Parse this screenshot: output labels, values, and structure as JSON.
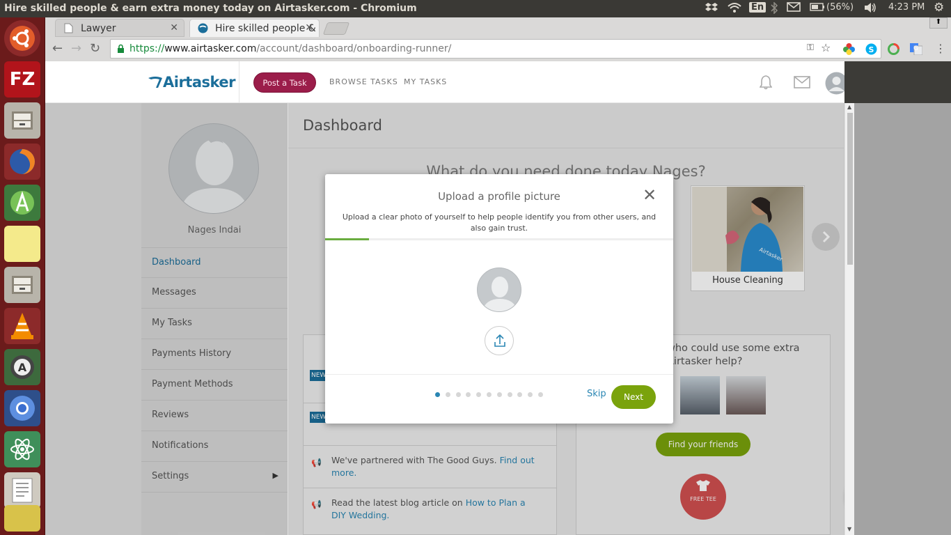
{
  "os": {
    "window_title": "Hire skilled people & earn extra money today on Airtasker.com - Chromium",
    "keyboard_layout": "En",
    "battery": "(56%)",
    "time": "4:23 PM"
  },
  "browser": {
    "tabs": [
      {
        "label": "Lawyer",
        "active": false
      },
      {
        "label": "Hire skilled people & earn",
        "active": true
      }
    ],
    "url_scheme": "https://",
    "url_host": "www.airtasker.com",
    "url_path": "/account/dashboard/onboarding-runner/"
  },
  "site_header": {
    "logo": "Airtasker",
    "post_task_label": "Post a Task",
    "nav": [
      "BROWSE TASKS",
      "MY TASKS"
    ]
  },
  "sidebar": {
    "user_name": "Nages Indai",
    "menu": [
      {
        "label": "Dashboard",
        "active": true
      },
      {
        "label": "Messages",
        "active": false
      },
      {
        "label": "My Tasks",
        "active": false
      },
      {
        "label": "Payments History",
        "active": false
      },
      {
        "label": "Payment Methods",
        "active": false
      },
      {
        "label": "Reviews",
        "active": false
      },
      {
        "label": "Notifications",
        "active": false
      },
      {
        "label": "Settings",
        "active": false
      }
    ]
  },
  "main": {
    "title": "Dashboard",
    "prompt": "What do you need done today Nages?",
    "category_card": "House Cleaning",
    "news_badge": "NEW",
    "news": [
      {
        "text": "We've partnered with The Good Guys.",
        "link": "Find out more."
      },
      {
        "text": "Read the latest blog article on",
        "link": "How to Plan a DIY Wedding."
      }
    ],
    "refer_heading": "who could use some extra Airtasker help?",
    "find_friends_label": "Find your friends",
    "free_tee_label": "FREE TEE"
  },
  "modal": {
    "title": "Upload a profile picture",
    "description": "Upload a clear photo of yourself to help people identify you from other users, and also gain trust.",
    "progress": 0.125,
    "step_count": 11,
    "current_step": 1,
    "skip_label": "Skip",
    "next_label": "Next"
  },
  "colors": {
    "brand_blue": "#2a86b3",
    "post_task_bg": "#9b1d4a",
    "next_green": "#7aa30c",
    "progress_green": "#6aad3f"
  }
}
